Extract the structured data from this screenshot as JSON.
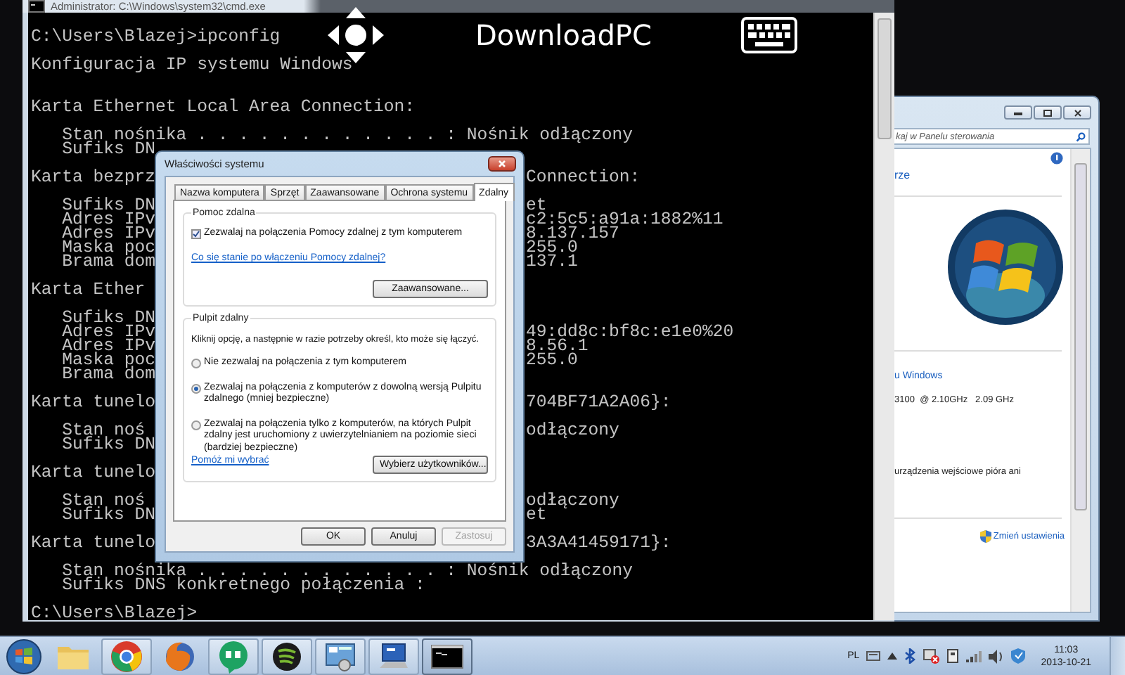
{
  "remote_bar": {
    "title": "DownloadPC"
  },
  "console": {
    "title": "Administrator: C:\\Windows\\system32\\cmd.exe",
    "blocks": [
      {
        "kind": "command",
        "lines": [
          {
            "text": "C:\\Users\\Blazej>ipconfig"
          }
        ]
      },
      {
        "kind": "title",
        "lines": [
          {
            "text": "Konfiguracja IP systemu Windows"
          }
        ]
      },
      {
        "kind": "adapter",
        "lines": [
          {
            "text": "Karta Ethernet Local Area Connection:"
          }
        ]
      },
      {
        "kind": "details",
        "lines": [
          {
            "text": "Stan nośnika . . . . . . . . . . . . : Nośnik odłączony"
          },
          {
            "text": "Sufiks DN"
          }
        ]
      },
      {
        "kind": "adapter",
        "lines": [
          {
            "text": "Karta bezprz",
            "tail": "Connection:"
          }
        ]
      },
      {
        "kind": "details",
        "lines": [
          {
            "text": "Sufiks DN",
            "tail": "et"
          },
          {
            "text": "Adres IPv",
            "tail": "c2:5c5:a91a:1882%11"
          },
          {
            "text": "Adres IPv",
            "tail": "8.137.157"
          },
          {
            "text": "Maska poc",
            "tail": "255.0"
          },
          {
            "text": "Brama dom",
            "tail": "137.1"
          }
        ]
      },
      {
        "kind": "adapter",
        "lines": [
          {
            "text": "Karta Ether"
          }
        ]
      },
      {
        "kind": "details",
        "lines": [
          {
            "text": "Sufiks DN"
          },
          {
            "text": "Adres IPv",
            "tail": "49:dd8c:bf8c:e1e0%20"
          },
          {
            "text": "Adres IPv",
            "tail": "8.56.1"
          },
          {
            "text": "Maska poc",
            "tail": "255.0"
          },
          {
            "text": "Brama dom"
          }
        ]
      },
      {
        "kind": "adapter",
        "lines": [
          {
            "text": "Karta tunelo",
            "tail": "704BF71A2A06}:"
          }
        ]
      },
      {
        "kind": "details",
        "lines": [
          {
            "text": "Stan noś",
            "tail": "odłączony"
          },
          {
            "text": "Sufiks DN"
          }
        ]
      },
      {
        "kind": "adapter",
        "lines": [
          {
            "text": "Karta tunelo"
          }
        ]
      },
      {
        "kind": "details",
        "lines": [
          {
            "text": "Stan noś",
            "tail": "odłączony"
          },
          {
            "text": "Sufiks DN",
            "tail": "et"
          }
        ]
      },
      {
        "kind": "adapter",
        "lines": [
          {
            "text": "Karta tunelo",
            "tail": "3A3A41459171}:"
          }
        ]
      },
      {
        "kind": "details",
        "lines": [
          {
            "text": "Stan nośnika . . . . . . . . . . . . : Nośnik odłączony"
          },
          {
            "text": "Sufiks DNS konkretnego połączenia :"
          }
        ]
      },
      {
        "kind": "command",
        "lines": [
          {
            "text": "C:\\Users\\Blazej>"
          }
        ]
      }
    ]
  },
  "dialog": {
    "title": "Właściwości systemu",
    "tabs": [
      {
        "label": "Nazwa komputera",
        "selected": false
      },
      {
        "label": "Sprzęt",
        "selected": false
      },
      {
        "label": "Zaawansowane",
        "selected": false
      },
      {
        "label": "Ochrona systemu",
        "selected": false
      },
      {
        "label": "Zdalny",
        "selected": true
      }
    ],
    "assistance": {
      "heading": "Pomoc zdalna",
      "checkbox": {
        "label": "Zezwalaj na połączenia Pomocy zdalnej z tym komputerem",
        "checked": true
      },
      "link": "Co się stanie po włączeniu Pomocy zdalnej?",
      "button": "Zaawansowane..."
    },
    "desktop": {
      "heading": "Pulpit zdalny",
      "instruction": "Kliknij opcję, a następnie w razie potrzeby określ, kto może się łączyć.",
      "options": [
        {
          "label": "Nie zezwalaj na połączenia z tym komputerem",
          "selected": false
        },
        {
          "label": "Zezwalaj na połączenia z komputerów z dowolną wersją Pulpitu zdalnego (mniej bezpieczne)",
          "selected": true
        },
        {
          "label": "Zezwalaj na połączenia tylko z komputerów, na których Pulpit zdalny jest uruchomiony z uwierzytelnianiem na poziomie sieci (bardziej bezpieczne)",
          "selected": false
        }
      ],
      "link": "Pomóż mi wybrać",
      "button": "Wybierz użytkowników..."
    },
    "buttons": [
      {
        "label": "OK",
        "disabled": false
      },
      {
        "label": "Anuluj",
        "disabled": false
      },
      {
        "label": "Zastosuj",
        "disabled": true
      }
    ]
  },
  "control_panel": {
    "search": {
      "placeholder": "kaj w Panelu sterowania"
    },
    "heading": "rze",
    "edition_link": "u Windows",
    "processor": "3100  @ 2.10GHz   2.09 GHz",
    "pen": "urządzenia wejściowe pióra ani",
    "change_link": "Zmień ustawienia"
  },
  "taskbar": {
    "apps": [
      {
        "kind": "folder",
        "running": false,
        "selected": false
      },
      {
        "kind": "browser",
        "running": true,
        "selected": false
      },
      {
        "kind": "fox",
        "running": false,
        "selected": false
      },
      {
        "kind": "chat",
        "running": true,
        "selected": false
      },
      {
        "kind": "music",
        "running": true,
        "selected": false
      },
      {
        "kind": "panel",
        "running": true,
        "selected": false
      },
      {
        "kind": "system",
        "running": true,
        "selected": false
      },
      {
        "kind": "terminal",
        "running": true,
        "selected": true
      }
    ],
    "language": "PL",
    "time": "11:03",
    "date": "2013-10-21"
  }
}
